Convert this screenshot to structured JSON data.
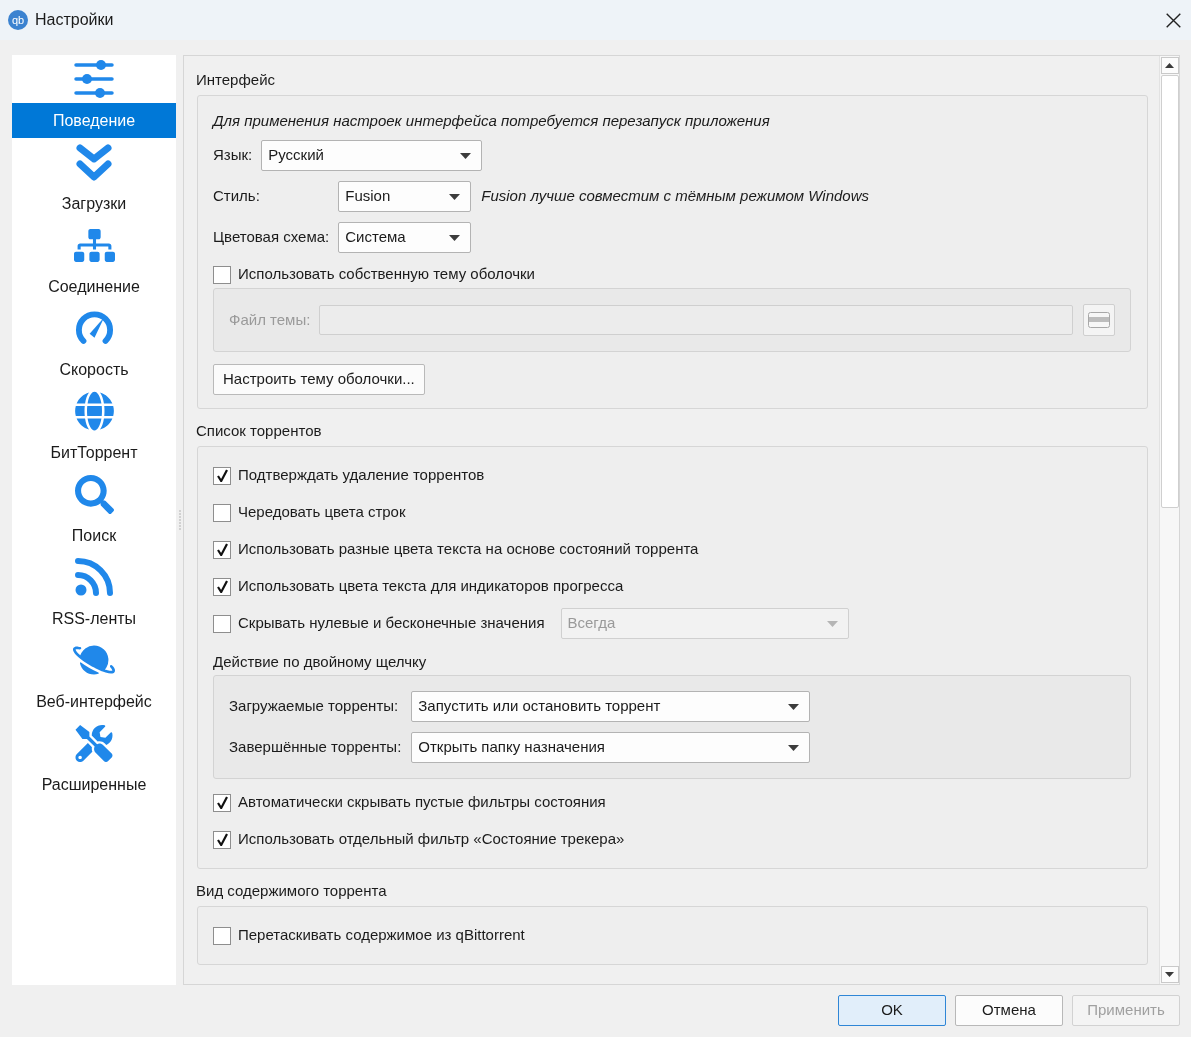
{
  "window": {
    "logo_text": "qb",
    "title": "Настройки"
  },
  "sidebar": {
    "items": [
      {
        "label": "Поведение",
        "selected": true
      },
      {
        "label": "Загрузки",
        "selected": false
      },
      {
        "label": "Соединение",
        "selected": false
      },
      {
        "label": "Скорость",
        "selected": false
      },
      {
        "label": "БитТоррент",
        "selected": false
      },
      {
        "label": "Поиск",
        "selected": false
      },
      {
        "label": "RSS-ленты",
        "selected": false
      },
      {
        "label": "Веб-интерфейс",
        "selected": false
      },
      {
        "label": "Расширенные",
        "selected": false
      }
    ]
  },
  "sections": [
    {
      "title": "Интерфейс",
      "rows": [
        {
          "kind": "note",
          "text": "Для применения настроек интерфейса потребуется перезапуск приложения"
        },
        {
          "kind": "combo",
          "label": "Язык:",
          "value": "Русский"
        },
        {
          "kind": "form",
          "rows": [
            {
              "label": "Стиль:",
              "value": "Fusion",
              "note": "Fusion лучше совместим с тёмным режимом Windows"
            },
            {
              "label": "Цветовая схема:",
              "value": "Система"
            }
          ]
        },
        {
          "kind": "checkbox",
          "label": "Использовать собственную тему оболочки",
          "checked": false
        },
        {
          "kind": "subgroup",
          "rows": [
            {
              "kind": "file",
              "label": "Файл темы:",
              "disabled": true
            }
          ]
        },
        {
          "kind": "button",
          "label": "Настроить тему оболочки..."
        }
      ]
    },
    {
      "title": "Список торрентов",
      "rows": [
        {
          "kind": "checkbox",
          "label": "Подтверждать удаление торрентов",
          "checked": true
        },
        {
          "kind": "checkbox",
          "label": "Чередовать цвета строк",
          "checked": false
        },
        {
          "kind": "checkbox",
          "label": "Использовать разные цвета текста на основе состояний торрента",
          "checked": true
        },
        {
          "kind": "checkbox",
          "label": "Использовать цвета текста для индикаторов прогресса",
          "checked": true
        },
        {
          "kind": "checkbox",
          "label": "Скрывать нулевые и бесконечные значения",
          "checked": false,
          "combo": {
            "value": "Всегда",
            "disabled": true
          }
        },
        {
          "kind": "heading",
          "text": "Действие по двойному щелчку"
        },
        {
          "kind": "subgroup",
          "rows": [
            {
              "kind": "form",
              "rows": [
                {
                  "label": "Загружаемые торренты:",
                  "value": "Запустить или остановить торрент"
                },
                {
                  "label": "Завершённые торренты:",
                  "value": "Открыть папку назначения"
                }
              ]
            }
          ]
        },
        {
          "kind": "checkbox",
          "label": "Автоматически скрывать пустые фильтры состояния",
          "checked": true
        },
        {
          "kind": "checkbox",
          "label": "Использовать отдельный фильтр «Состояние трекера»",
          "checked": true
        }
      ]
    },
    {
      "title": "Вид содержимого торрента",
      "rows": [
        {
          "kind": "checkbox",
          "label": "Перетаскивать содержимое из qBittorrent",
          "checked": false
        }
      ]
    }
  ],
  "buttons": [
    {
      "label": "OK",
      "default": true,
      "disabled": false
    },
    {
      "label": "Отмена",
      "default": false,
      "disabled": false
    },
    {
      "label": "Применить",
      "default": false,
      "disabled": true
    }
  ]
}
